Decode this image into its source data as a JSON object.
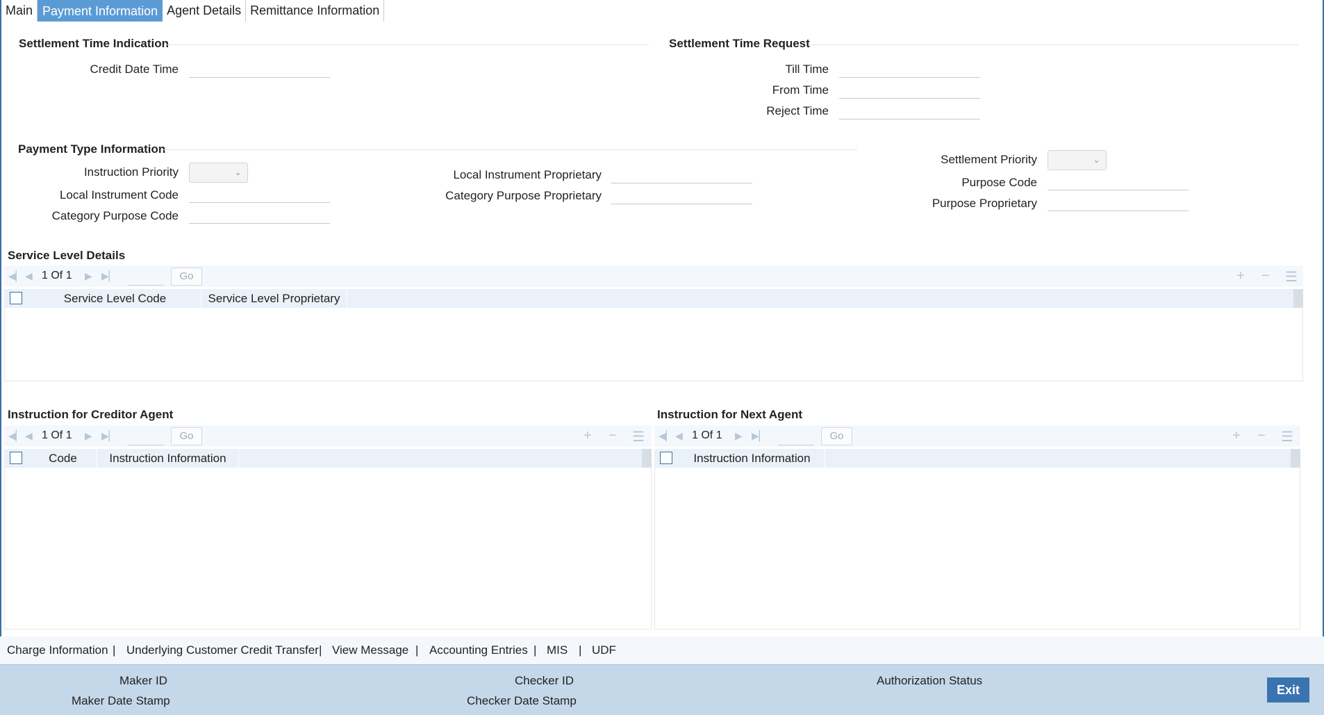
{
  "tabs": [
    {
      "label": "Main",
      "active": false
    },
    {
      "label": "Payment Information",
      "active": true
    },
    {
      "label": "Agent Details",
      "active": false
    },
    {
      "label": "Remittance Information",
      "active": false
    }
  ],
  "settlement_time_indication": {
    "title": "Settlement Time Indication",
    "credit_date_time_label": "Credit Date Time",
    "credit_date_time_value": ""
  },
  "settlement_time_request": {
    "title": "Settlement Time Request",
    "till_time_label": "Till Time",
    "from_time_label": "From Time",
    "reject_time_label": "Reject Time"
  },
  "payment_type_information": {
    "title": "Payment Type Information",
    "instruction_priority_label": "Instruction Priority",
    "instruction_priority_value": "",
    "local_instrument_code_label": "Local Instrument Code",
    "category_purpose_code_label": "Category Purpose Code",
    "local_instrument_proprietary_label": "Local Instrument Proprietary",
    "category_purpose_proprietary_label": "Category Purpose Proprietary",
    "settlement_priority_label": "Settlement Priority",
    "settlement_priority_value": "",
    "purpose_code_label": "Purpose Code",
    "purpose_proprietary_label": "Purpose Proprietary"
  },
  "service_level_details": {
    "title": "Service Level Details",
    "pager_current": "1",
    "pager_of": "Of",
    "pager_total": "1",
    "go_label": "Go",
    "columns": [
      "Service Level Code",
      "Service Level Proprietary"
    ]
  },
  "creditor_agent": {
    "title": "Instruction for Creditor Agent",
    "pager_current": "1",
    "pager_of": "Of",
    "pager_total": "1",
    "go_label": "Go",
    "columns": [
      "Code",
      "Instruction Information"
    ]
  },
  "next_agent": {
    "title": "Instruction for Next Agent",
    "pager_current": "1",
    "pager_of": "Of",
    "pager_total": "1",
    "go_label": "Go",
    "columns": [
      "Instruction Information"
    ]
  },
  "bottom_links": [
    "Charge Information",
    "Underlying Customer Credit Transfer",
    "View Message",
    "Accounting Entries",
    "MIS",
    "UDF"
  ],
  "link_separator": "|",
  "footer": {
    "maker_id": "Maker ID",
    "maker_date_stamp": "Maker Date Stamp",
    "checker_id": "Checker ID",
    "checker_date_stamp": "Checker Date Stamp",
    "authorization_status": "Authorization Status",
    "exit_label": "Exit"
  },
  "icons": {
    "first": "first-page-icon",
    "prev": "previous-page-icon",
    "next": "next-page-icon",
    "last": "last-page-icon",
    "add": "add-row-icon",
    "delete": "delete-row-icon",
    "columns": "column-list-icon"
  },
  "colors": {
    "active_tab": "#5b9bd5",
    "footer_bg": "#c5d8ea",
    "exit_button": "#3a74b0",
    "grid_header": "#eaf1f8"
  }
}
